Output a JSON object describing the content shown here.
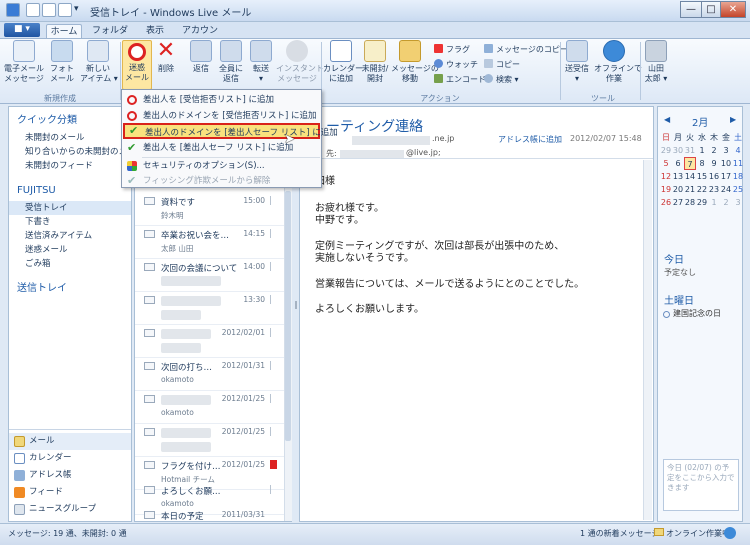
{
  "window": {
    "title": "受信トレイ - Windows Live メール",
    "min": "—",
    "max": "□",
    "close": "✕"
  },
  "tabs": {
    "file": "■ ▾",
    "home": "ホーム",
    "folder": "フォルダー",
    "view": "表示",
    "account": "アカウント"
  },
  "ribbon": {
    "new_group": "新規作成",
    "new_email": "電子メール\nメッセージ",
    "new_photo": "フォト\nメール",
    "new_item": "新しい\nアイテム ▾",
    "junk": "迷惑\nメール",
    "delete": "削除",
    "reply": "返信",
    "reply_all": "全員に\n返信",
    "forward": "転送\n▾",
    "im": "インスタント\nメッセージ",
    "add_calendar": "カレンダー\nに追加",
    "unread_read": "未開封/\n開封",
    "move": "メッセージの\n移動",
    "flag": "フラグ",
    "watch": "ウォッチ",
    "encode": "エンコード",
    "copy_msg": "メッセージのコピー",
    "copy": "コピー",
    "find": "検索 ▾",
    "action_group": "アクション",
    "sendrecv": "送受信\n▾",
    "offline": "オフラインで\n作業",
    "user": "山田\n太郎 ▾",
    "tools_group": "ツール"
  },
  "dropdown": [
    {
      "label": "差出人を [受信拒否リスト] に追加",
      "icon": "block-icon"
    },
    {
      "label": "差出人のドメインを [受信拒否リスト] に追加",
      "icon": "block-icon"
    },
    {
      "label": "差出人のドメインを [差出人セーフ リスト] に追加",
      "icon": "check-icon"
    },
    {
      "label": "差出人を [差出人セーフ リスト] に追加",
      "icon": "check-icon"
    },
    {
      "label": "セキュリティのオプション(S)...",
      "icon": "shield-icon"
    },
    {
      "label": "フィッシング詐欺メールから解除",
      "icon": "check-gray-icon"
    }
  ],
  "left": {
    "quick": "クイック分類",
    "unread_mail": "未開封のメール",
    "unread_contacts": "知り合いからの未開封のメ",
    "unread_feeds": "未開封のフィード",
    "account": "FUJITSU",
    "inbox": "受信トレイ",
    "drafts": "下書き",
    "sent": "送信済みアイテム",
    "junk": "迷惑メール",
    "trash": "ごみ箱",
    "outbox": "送信トレイ",
    "nav_mail": "メール",
    "nav_calendar": "カレンダー",
    "nav_contacts": "アドレス帳",
    "nav_feeds": "フィード",
    "nav_news": "ニュースグループ"
  },
  "messages": [
    {
      "subject": "資料です",
      "from": "鈴木明",
      "date": "15:00"
    },
    {
      "subject": "卒業お祝い会を…",
      "from": "太郎 山田",
      "date": "14:15"
    },
    {
      "subject": "次回の会議について",
      "from": "",
      "date": "14:00"
    },
    {
      "subject": "",
      "from": "",
      "date": "13:30"
    },
    {
      "subject": "",
      "from": "",
      "date": "2012/02/01"
    },
    {
      "subject": "次回の打ち…",
      "from": "okamoto",
      "date": "2012/01/31"
    },
    {
      "subject": "",
      "from": "okamoto",
      "date": "2012/01/25"
    },
    {
      "subject": "",
      "from": "",
      "date": "2012/01/25"
    },
    {
      "subject": "フラグを付け…",
      "from": "Hotmail チーム",
      "date": "2012/01/25"
    },
    {
      "subject": "よろしくお願…",
      "from": "okamoto",
      "date": "2012/01/25"
    },
    {
      "subject": "本日の予定",
      "from": "",
      "date": "2011/03/31"
    }
  ],
  "reading": {
    "subject": "ーティング連絡",
    "from_domain": ".ne.jp",
    "add_contact": "アドレス帳に追加",
    "date": "2012/02/07 15:48",
    "to": "先:",
    "to_addr": "@live.jp;",
    "body": [
      "田様",
      "お疲れ様です。",
      "中野です。",
      "定例ミーティングですが、次回は部長が出張中のため、",
      "実施しないそうです。",
      "営業報告については、メールで送るようにとのことでした。",
      "よろしくお願いします。"
    ]
  },
  "calendar": {
    "month": "2月",
    "prev": "◀",
    "next": "▶",
    "weekdays": [
      "日",
      "月",
      "火",
      "水",
      "木",
      "金",
      "土"
    ],
    "rows": [
      [
        "29",
        "30",
        "31",
        "1",
        "2",
        "3",
        "4"
      ],
      [
        "5",
        "6",
        "7",
        "8",
        "9",
        "10",
        "11"
      ],
      [
        "12",
        "13",
        "14",
        "15",
        "16",
        "17",
        "18"
      ],
      [
        "19",
        "20",
        "21",
        "22",
        "23",
        "24",
        "25"
      ],
      [
        "26",
        "27",
        "28",
        "29",
        "1",
        "2",
        "3"
      ]
    ],
    "today": "今日",
    "today_none": "予定なし",
    "saturday": "土曜日",
    "holiday": "建国記念の日",
    "quick_add": "今日 (02/07) の予定をここから入力できます"
  },
  "status": {
    "left": "メッセージ: 19 通、未開封: 0 通",
    "new": "1 通の新着メッセージ",
    "online": "オンライン作業中"
  },
  "colors": {
    "accent": "#1f5ca8",
    "highlight_border": "#d9221a",
    "highlight_fill": "#f9e27e"
  }
}
